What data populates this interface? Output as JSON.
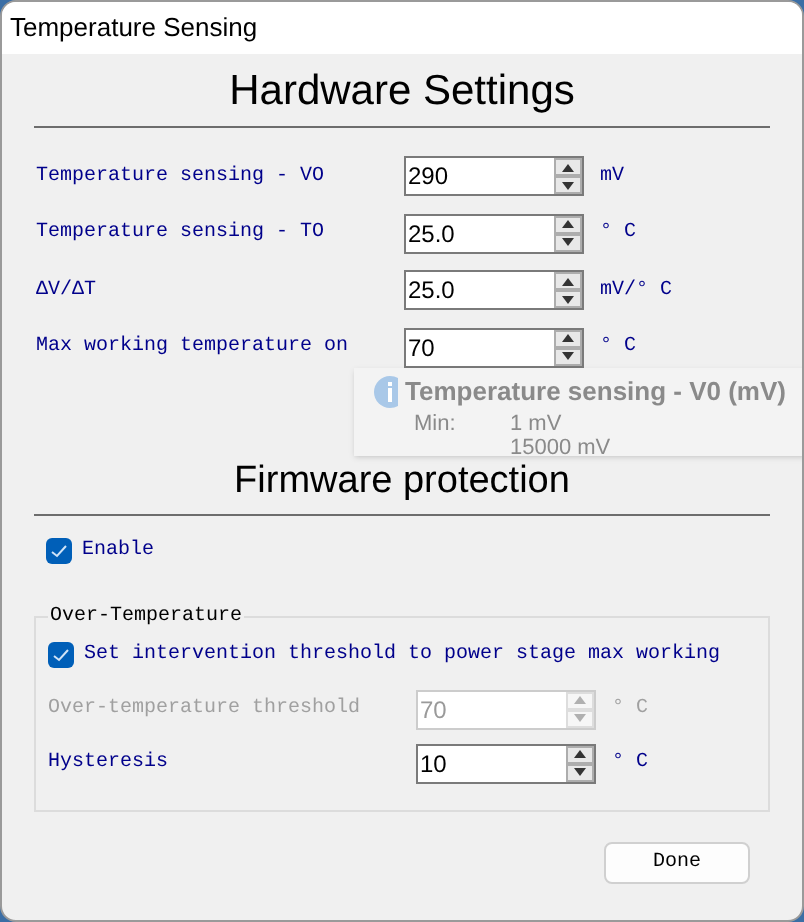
{
  "window": {
    "title": "Temperature Sensing"
  },
  "hardware": {
    "title": "Hardware Settings",
    "rows": [
      {
        "label": "Temperature sensing - VO",
        "value": "290",
        "unit": "mV"
      },
      {
        "label": "Temperature sensing - TO",
        "value": "25.0",
        "unit": "° C"
      },
      {
        "label": "ΔV/ΔT",
        "value": "25.0",
        "unit": "mV/° C"
      },
      {
        "label": "Max working temperature on",
        "value": "70",
        "unit": "° C"
      }
    ]
  },
  "tooltip": {
    "title": "Temperature sensing - V0 (mV)",
    "rows": [
      {
        "label": "Min:",
        "value": "1 mV"
      },
      {
        "value": "15000 mV"
      }
    ]
  },
  "firmware": {
    "title": "Firmware protection",
    "enable": {
      "label": "Enable",
      "checked": true
    },
    "group": {
      "title": "Over-Temperature",
      "option": {
        "label": "Set intervention threshold to power stage max working",
        "checked": true
      },
      "rows": [
        {
          "label": "Over-temperature threshold",
          "value": "70",
          "unit": "° C",
          "disabled": true
        },
        {
          "label": "Hysteresis",
          "value": "10",
          "unit": "° C",
          "disabled": false
        }
      ]
    }
  },
  "buttons": [
    {
      "label": "Done"
    }
  ]
}
